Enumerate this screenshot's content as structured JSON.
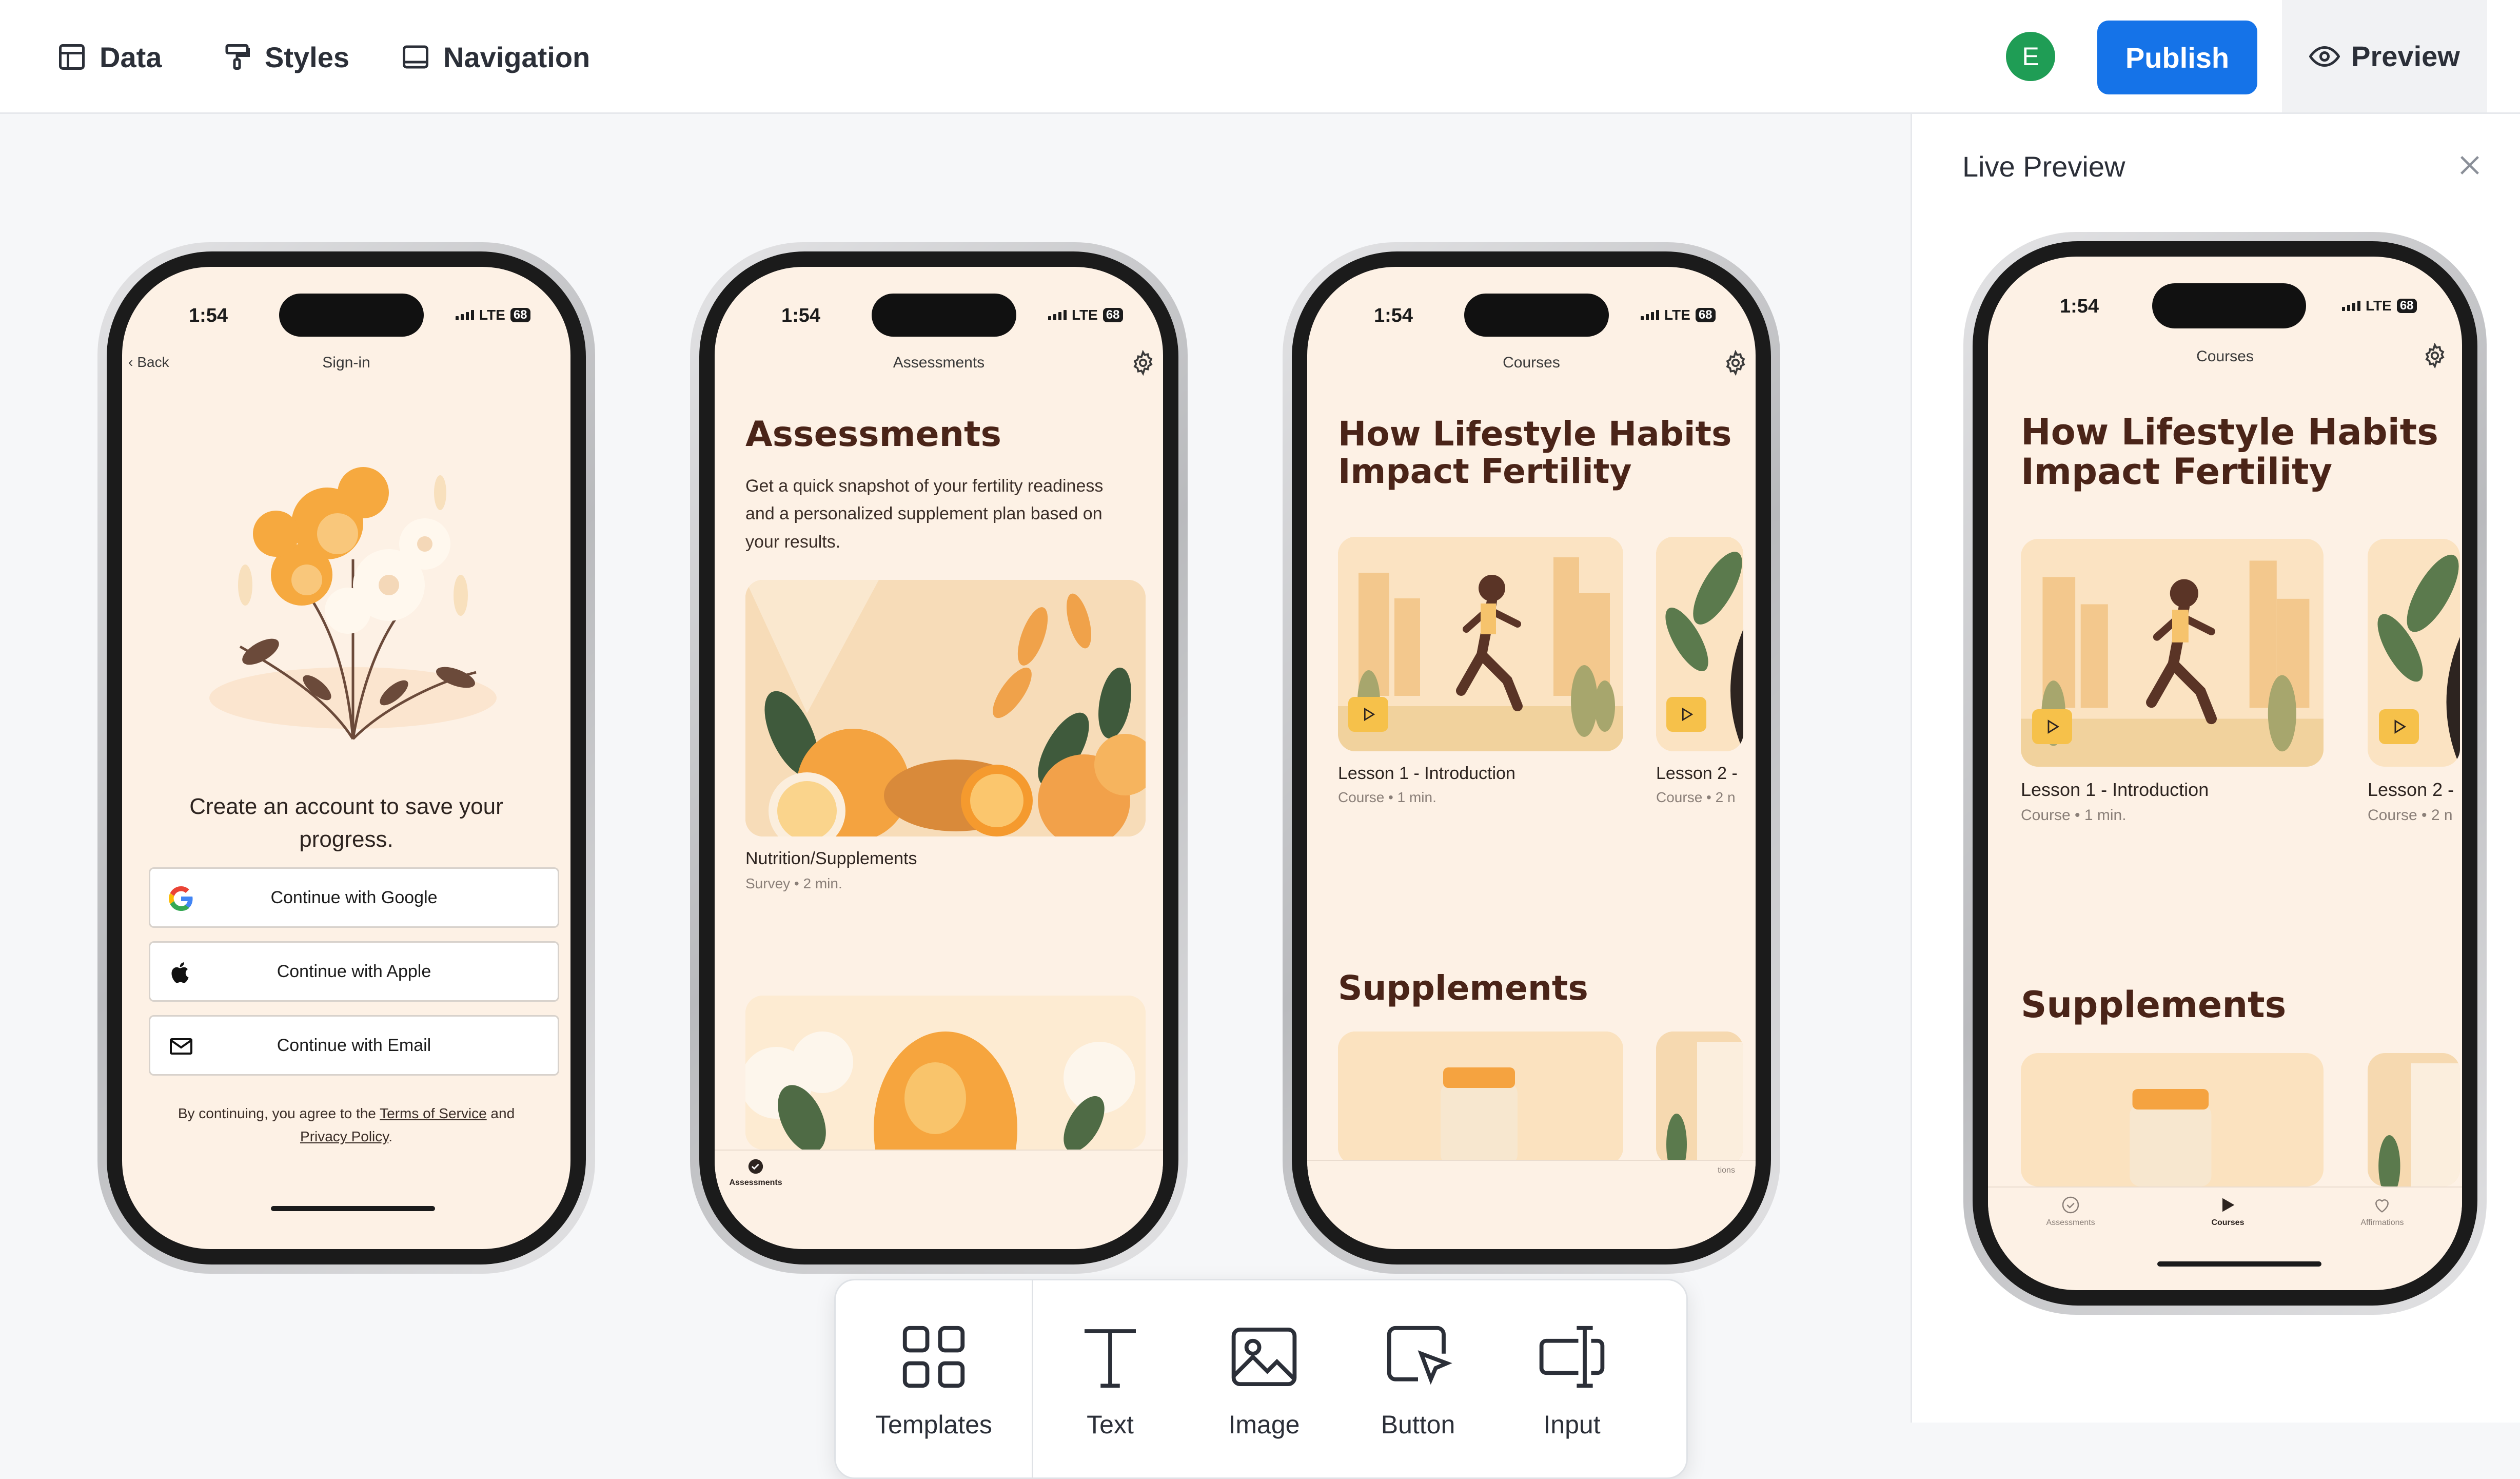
{
  "topbar": {
    "tabs": [
      {
        "label": "Data",
        "icon": "table-icon"
      },
      {
        "label": "Styles",
        "icon": "paint-roller-icon"
      },
      {
        "label": "Navigation",
        "icon": "tablet-icon"
      }
    ],
    "avatar_initial": "E",
    "publish_label": "Publish",
    "preview_label": "Preview"
  },
  "side_panel": {
    "title": "Live Preview"
  },
  "status": {
    "time": "1:54",
    "network": "LTE",
    "battery": "68"
  },
  "screen_signin": {
    "back_label": "Back",
    "header": "Sign-in",
    "prompt": "Create an account to save your progress.",
    "google_label": "Continue with Google",
    "apple_label": "Continue with Apple",
    "email_label": "Continue with Email",
    "legal_prefix": "By continuing, you agree to the ",
    "terms_link": "Terms of Service",
    "legal_and": " and ",
    "privacy_link": "Privacy Policy",
    "legal_suffix": "."
  },
  "screen_assessments": {
    "header": "Assessments",
    "title": "Assessments",
    "description": "Get a quick snapshot of your fertility readiness and a personalized supplement plan based on your results.",
    "card1_label": "Nutrition/Supplements",
    "card1_meta": "Survey • 2 min.",
    "nav_active": "Assessments"
  },
  "screen_courses": {
    "header": "Courses",
    "title_line1": "How Lifestyle Habits",
    "title_line2": "Impact Fertility",
    "lesson1_label": "Lesson 1 - Introduction",
    "lesson1_meta": "Course • 1 min.",
    "lesson2_label": "Lesson 2 -",
    "lesson2_meta": "Course • 2 n",
    "section2": "Supplements",
    "nav_partial": "tions"
  },
  "live_preview": {
    "header": "Courses",
    "title_line1": "How Lifestyle Habits",
    "title_line2": "Impact Fertility",
    "lesson1_label": "Lesson 1 - Introduction",
    "lesson1_meta": "Course • 1 min.",
    "lesson2_label": "Lesson 2 -",
    "lesson2_meta": "Course • 2 n",
    "section2": "Supplements",
    "nav": [
      "Assessments",
      "Courses",
      "Affirmations"
    ]
  },
  "toolbar": {
    "items": [
      {
        "label": "Templates",
        "icon": "grid-icon"
      },
      {
        "label": "Text",
        "icon": "text-icon"
      },
      {
        "label": "Image",
        "icon": "image-icon"
      },
      {
        "label": "Button",
        "icon": "cursor-button-icon"
      },
      {
        "label": "Input",
        "icon": "text-input-icon"
      }
    ]
  },
  "colors": {
    "accent": "#1573e8",
    "screen_bg": "#fdf1e5",
    "title": "#4a2418",
    "avatar": "#1f9d55"
  }
}
